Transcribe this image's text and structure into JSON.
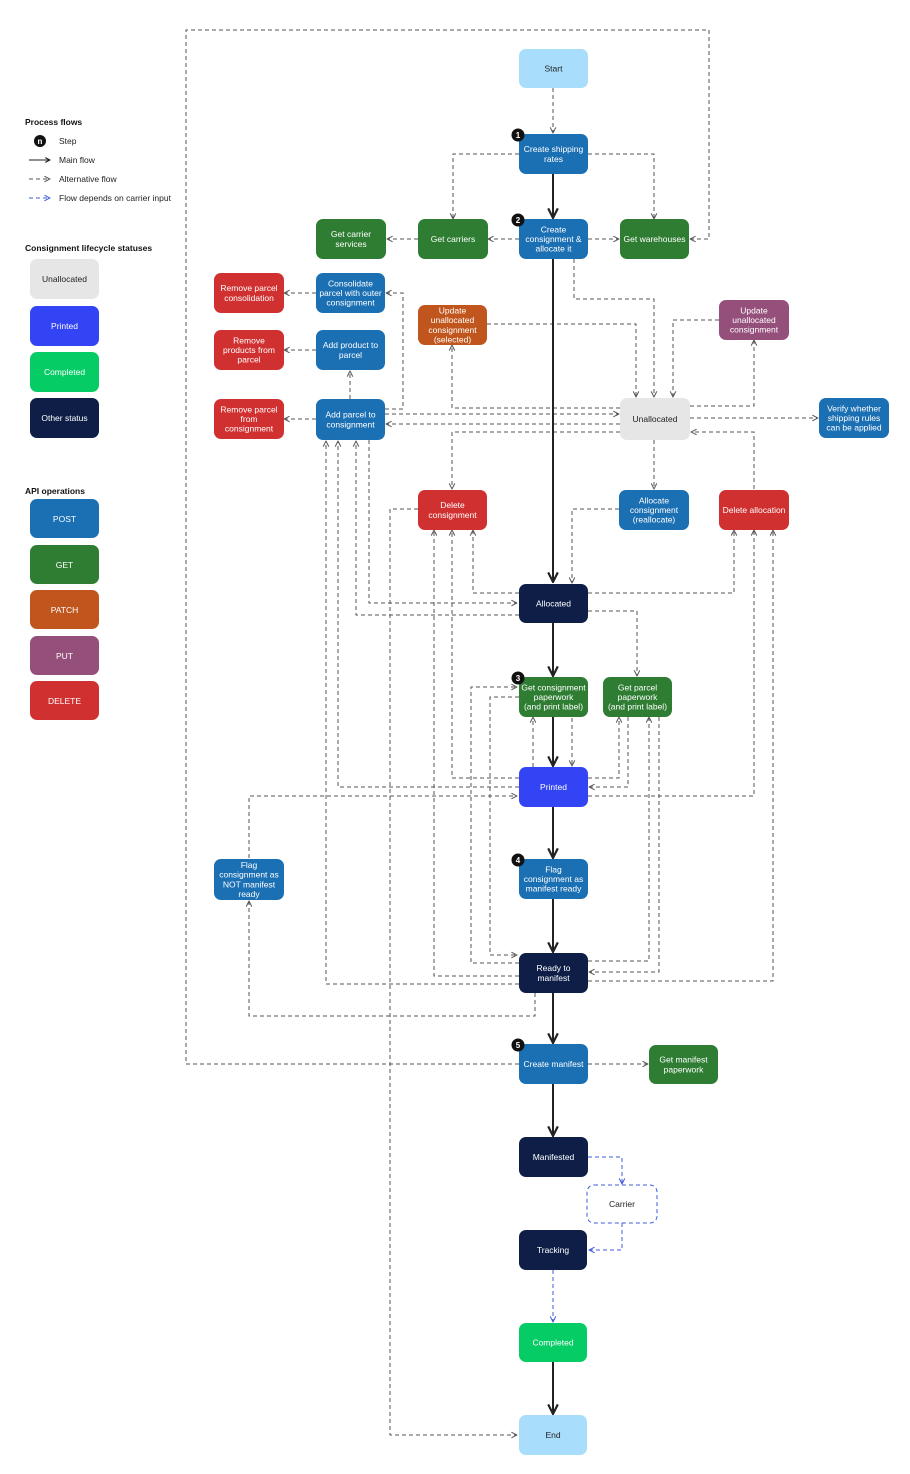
{
  "colors": {
    "post": "#1b6fb3",
    "get": "#2e7d32",
    "patch": "#c0561e",
    "put": "#954f7b",
    "delete": "#d03030",
    "unallocated": "#e6e6e6",
    "printed": "#3344f5",
    "completed": "#06cc66",
    "other_status": "#0e1e47",
    "terminal": "#a8ddfb",
    "badge": "#111111",
    "alt_flow": "#555555",
    "main_flow": "#222222",
    "carrier_flow": "#3b5bdb"
  },
  "legend": {
    "process_flows_title": "Process flows",
    "step_badge": "n",
    "step_label": "Step",
    "main_flow_label": "Main flow",
    "alt_flow_label": "Alternative flow",
    "carrier_flow_label": "Flow depends on carrier input",
    "statuses_title": "Consignment lifecycle statuses",
    "statuses": [
      {
        "label": "Unallocated",
        "color": "#e6e6e6",
        "text": "#222222"
      },
      {
        "label": "Printed",
        "color": "#3344f5",
        "text": "#ffffff"
      },
      {
        "label": "Completed",
        "color": "#06cc66",
        "text": "#ffffff"
      },
      {
        "label": "Other status",
        "color": "#0e1e47",
        "text": "#ffffff"
      }
    ],
    "api_title": "API operations",
    "api_ops": [
      {
        "label": "POST",
        "color": "#1b6fb3"
      },
      {
        "label": "GET",
        "color": "#2e7d32"
      },
      {
        "label": "PATCH",
        "color": "#c0561e"
      },
      {
        "label": "PUT",
        "color": "#954f7b"
      },
      {
        "label": "DELETE",
        "color": "#d03030"
      }
    ]
  },
  "nodes": [
    {
      "id": "start",
      "lines": [
        "Start"
      ],
      "kind": "terminal"
    },
    {
      "id": "create-shipping-rates",
      "lines": [
        "Create shipping",
        "rates"
      ],
      "kind": "post",
      "step": "1"
    },
    {
      "id": "create-consignment",
      "lines": [
        "Create",
        "consignment &",
        "allocate it"
      ],
      "kind": "post",
      "step": "2"
    },
    {
      "id": "get-carrier-services",
      "lines": [
        "Get carrier",
        "services"
      ],
      "kind": "get"
    },
    {
      "id": "get-carriers",
      "lines": [
        "Get carriers"
      ],
      "kind": "get"
    },
    {
      "id": "get-warehouses",
      "lines": [
        "Get warehouses"
      ],
      "kind": "get"
    },
    {
      "id": "remove-parcel-consolidation",
      "lines": [
        "Remove parcel",
        "consolidation"
      ],
      "kind": "delete"
    },
    {
      "id": "consolidate-parcel",
      "lines": [
        "Consolidate",
        "parcel with outer",
        "consignment"
      ],
      "kind": "post"
    },
    {
      "id": "remove-products-from-parcel",
      "lines": [
        "Remove",
        "products from",
        "parcel"
      ],
      "kind": "delete"
    },
    {
      "id": "add-product-to-parcel",
      "lines": [
        "Add product to",
        "parcel"
      ],
      "kind": "post"
    },
    {
      "id": "remove-parcel-from-consignment",
      "lines": [
        "Remove parcel",
        "from",
        "consignment"
      ],
      "kind": "delete"
    },
    {
      "id": "add-parcel-to-consignment",
      "lines": [
        "Add parcel to",
        "consignment"
      ],
      "kind": "post"
    },
    {
      "id": "update-unallocated-selected",
      "lines": [
        "Update",
        "unallocated",
        "consignment",
        "(selected)"
      ],
      "kind": "patch"
    },
    {
      "id": "update-unallocated",
      "lines": [
        "Update",
        "unallocated",
        "consignment"
      ],
      "kind": "put"
    },
    {
      "id": "unallocated",
      "lines": [
        "Unallocated"
      ],
      "kind": "unallocated"
    },
    {
      "id": "verify-shipping-rules",
      "lines": [
        "Verify whether",
        "shipping rules",
        "can be applied"
      ],
      "kind": "post"
    },
    {
      "id": "delete-consignment",
      "lines": [
        "Delete",
        "consignment"
      ],
      "kind": "delete"
    },
    {
      "id": "allocate-consignment",
      "lines": [
        "Allocate",
        "consignment",
        "(reallocate)"
      ],
      "kind": "post"
    },
    {
      "id": "delete-allocation",
      "lines": [
        "Delete allocation"
      ],
      "kind": "delete"
    },
    {
      "id": "allocated",
      "lines": [
        "Allocated"
      ],
      "kind": "other_status"
    },
    {
      "id": "get-consignment-paperwork",
      "lines": [
        "Get consignment",
        "paperwork",
        "(and print label)"
      ],
      "kind": "get",
      "step": "3"
    },
    {
      "id": "get-parcel-paperwork",
      "lines": [
        "Get parcel",
        "paperwork",
        "(and print label)"
      ],
      "kind": "get"
    },
    {
      "id": "printed",
      "lines": [
        "Printed"
      ],
      "kind": "printed"
    },
    {
      "id": "flag-not-manifest-ready",
      "lines": [
        "Flag",
        "consignment as",
        "NOT manifest",
        "ready"
      ],
      "kind": "post"
    },
    {
      "id": "flag-manifest-ready",
      "lines": [
        "Flag",
        "consignment as",
        "manifest ready"
      ],
      "kind": "post",
      "step": "4"
    },
    {
      "id": "ready-to-manifest",
      "lines": [
        "Ready to",
        "manifest"
      ],
      "kind": "other_status"
    },
    {
      "id": "create-manifest",
      "lines": [
        "Create manifest"
      ],
      "kind": "post",
      "step": "5"
    },
    {
      "id": "get-manifest-paperwork",
      "lines": [
        "Get manifest",
        "paperwork"
      ],
      "kind": "get"
    },
    {
      "id": "manifested",
      "lines": [
        "Manifested"
      ],
      "kind": "other_status"
    },
    {
      "id": "carrier",
      "lines": [
        "Carrier"
      ],
      "kind": "carrier"
    },
    {
      "id": "tracking",
      "lines": [
        "Tracking"
      ],
      "kind": "other_status"
    },
    {
      "id": "completed",
      "lines": [
        "Completed"
      ],
      "kind": "completed"
    },
    {
      "id": "end",
      "lines": [
        "End"
      ],
      "kind": "terminal"
    }
  ]
}
